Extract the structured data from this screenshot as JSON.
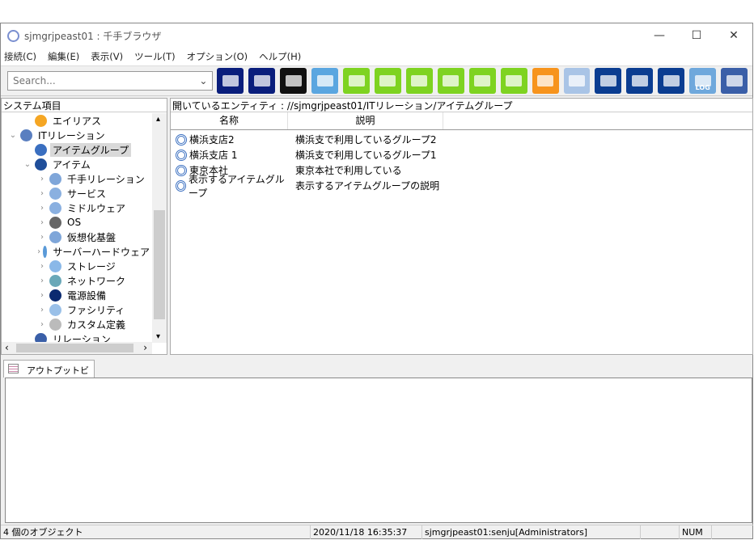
{
  "window": {
    "title": "sjmgrjpeast01 : 千手ブラウザ",
    "minimize": "—",
    "maximize": "☐",
    "close": "✕"
  },
  "menu": [
    "接続(C)",
    "編集(E)",
    "表示(V)",
    "ツール(T)",
    "オプション(O)",
    "ヘルプ(H)"
  ],
  "search": {
    "placeholder": "Search..."
  },
  "toolbar_icons": [
    {
      "name": "multi-monitor-icon",
      "color": "#0a1e7c"
    },
    {
      "name": "monitor-icon",
      "color": "#0a1e7c"
    },
    {
      "name": "database-monitor-icon",
      "color": "#111111"
    },
    {
      "name": "message-icon",
      "color": "#5aa6e0"
    },
    {
      "name": "gear-item-icon",
      "color": "#7ed321"
    },
    {
      "name": "check-item-icon",
      "color": "#7ed321"
    },
    {
      "name": "camera-item-icon",
      "color": "#7ed321"
    },
    {
      "name": "monitor-check-icon",
      "color": "#7ed321"
    },
    {
      "name": "bar-chart-icon",
      "color": "#7ed321"
    },
    {
      "name": "gantt-icon",
      "color": "#7ed321"
    },
    {
      "name": "report-chart-icon",
      "color": "#f7941d"
    },
    {
      "name": "puzzle-icon",
      "color": "#a9c4e6"
    },
    {
      "name": "gear-export-icon",
      "color": "#0b3d91"
    },
    {
      "name": "check-export-icon",
      "color": "#0b3d91"
    },
    {
      "name": "camera-export-icon",
      "color": "#0b3d91"
    },
    {
      "name": "log-icon",
      "color": "#6fa8dc",
      "label": "LOG"
    },
    {
      "name": "radar-icon",
      "color": "#3a5fa8"
    }
  ],
  "left_panel": {
    "title": "システム項目",
    "tree": [
      {
        "label": "エイリアス",
        "indent": 2,
        "arrow": "",
        "color": "#f5a623"
      },
      {
        "label": "ITリレーション",
        "indent": 1,
        "arrow": "⌄",
        "color": "#5a7fc0"
      },
      {
        "label": "アイテムグループ",
        "indent": 2,
        "arrow": "",
        "color": "#3a6fc0",
        "selected": true
      },
      {
        "label": "アイテム",
        "indent": 2,
        "arrow": "⌄",
        "color": "#1f4e9a"
      },
      {
        "label": "千手リレーション",
        "indent": 3,
        "arrow": "›",
        "color": "#7fa6d9"
      },
      {
        "label": "サービス",
        "indent": 3,
        "arrow": "›",
        "color": "#8ab0e0"
      },
      {
        "label": "ミドルウェア",
        "indent": 3,
        "arrow": "›",
        "color": "#8ab0e0"
      },
      {
        "label": "OS",
        "indent": 3,
        "arrow": "›",
        "color": "#666666"
      },
      {
        "label": "仮想化基盤",
        "indent": 3,
        "arrow": "›",
        "color": "#7fa6d9"
      },
      {
        "label": "サーバーハードウェア",
        "indent": 3,
        "arrow": "›",
        "color": "#5a9ad8"
      },
      {
        "label": "ストレージ",
        "indent": 3,
        "arrow": "›",
        "color": "#8ab8e8"
      },
      {
        "label": "ネットワーク",
        "indent": 3,
        "arrow": "›",
        "color": "#6aa8b8"
      },
      {
        "label": "電源設備",
        "indent": 3,
        "arrow": "›",
        "color": "#0b2a70"
      },
      {
        "label": "ファシリティ",
        "indent": 3,
        "arrow": "›",
        "color": "#9ac0e8"
      },
      {
        "label": "カスタム定義",
        "indent": 3,
        "arrow": "›",
        "color": "#bbbbbb"
      },
      {
        "label": "リレーション",
        "indent": 2,
        "arrow": "",
        "color": "#3a5fa8"
      }
    ]
  },
  "right_panel": {
    "path": "開いているエンティティ : //sjmgrjpeast01/ITリレーション/アイテムグループ",
    "columns": [
      "名称",
      "説明"
    ],
    "rows": [
      {
        "name": "横浜支店2",
        "desc": "横浜支で利用しているグループ2"
      },
      {
        "name": "横浜支店 1",
        "desc": "横浜支で利用しているグループ1"
      },
      {
        "name": "東京本社",
        "desc": "東京本社で利用している"
      },
      {
        "name": "表示するアイテムグループ",
        "desc": "表示するアイテムグループの説明"
      }
    ]
  },
  "output": {
    "tab": "アウトプットビュー"
  },
  "status": {
    "count": "4 個のオブジェクト",
    "datetime": "2020/11/18 16:35:37",
    "user": "sjmgrjpeast01:senju[Administrators]",
    "num": "NUM"
  }
}
